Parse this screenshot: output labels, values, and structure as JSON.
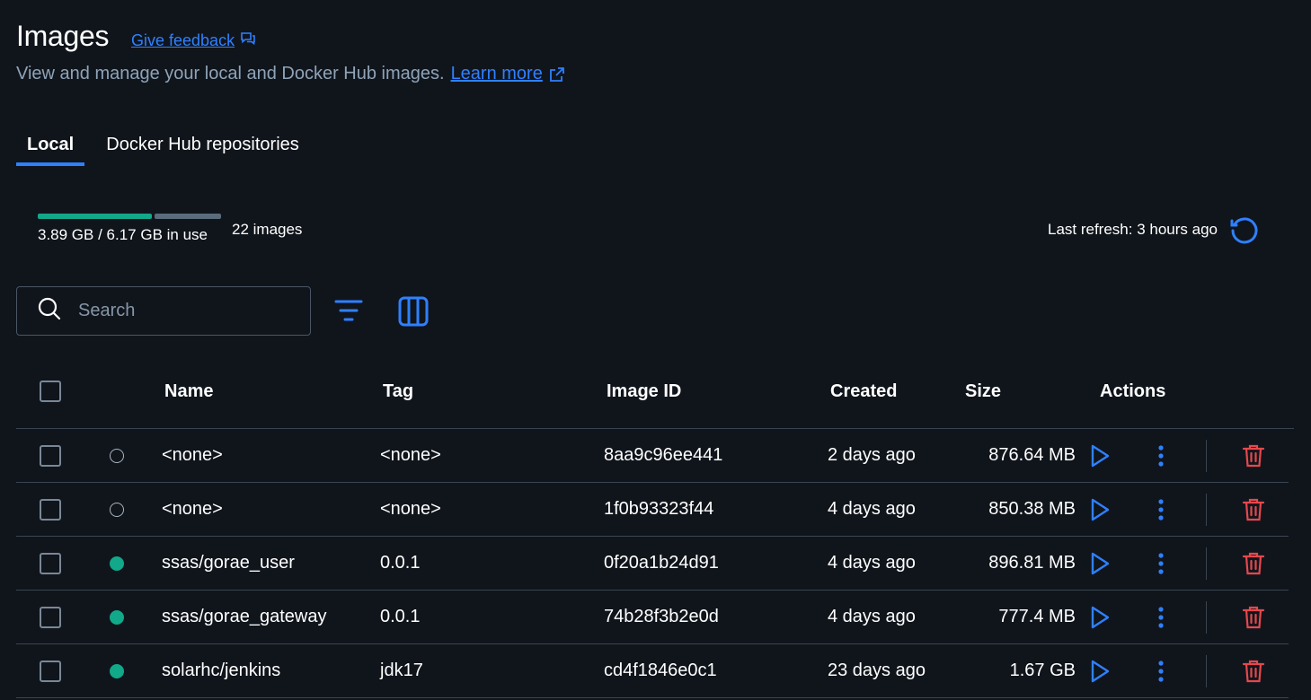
{
  "header": {
    "title": "Images",
    "feedback_label": "Give feedback",
    "subtitle": "View and manage your local and Docker Hub images.",
    "learn_more_label": "Learn more"
  },
  "tabs": [
    {
      "label": "Local",
      "active": true
    },
    {
      "label": "Docker Hub repositories",
      "active": false
    }
  ],
  "usage": {
    "text": "3.89 GB / 6.17 GB in use",
    "used_fraction": 0.63,
    "count_text": "22 images",
    "last_refresh": "Last refresh: 3 hours ago"
  },
  "search": {
    "placeholder": "Search",
    "value": ""
  },
  "table": {
    "columns": {
      "name": "Name",
      "tag": "Tag",
      "image_id": "Image ID",
      "created": "Created",
      "size": "Size",
      "actions": "Actions"
    },
    "rows": [
      {
        "name": "<none>",
        "tag": "<none>",
        "image_id": "8aa9c96ee441",
        "created": "2 days ago",
        "size": "876.64 MB",
        "in_use": false
      },
      {
        "name": "<none>",
        "tag": "<none>",
        "image_id": "1f0b93323f44",
        "created": "4 days ago",
        "size": "850.38 MB",
        "in_use": false
      },
      {
        "name": "ssas/gorae_user",
        "tag": "0.0.1",
        "image_id": "0f20a1b24d91",
        "created": "4 days ago",
        "size": "896.81 MB",
        "in_use": true
      },
      {
        "name": "ssas/gorae_gateway",
        "tag": "0.0.1",
        "image_id": "74b28f3b2e0d",
        "created": "4 days ago",
        "size": "777.4 MB",
        "in_use": true
      },
      {
        "name": "solarhc/jenkins",
        "tag": "jdk17",
        "image_id": "cd4f1846e0c1",
        "created": "23 days ago",
        "size": "1.67 GB",
        "in_use": true
      }
    ]
  },
  "icons": {
    "feedback": "chat-bubble-icon",
    "learn_more": "external-link-icon",
    "refresh": "refresh-icon",
    "search": "search-icon",
    "filter": "filter-icon",
    "columns": "columns-icon",
    "run": "play-icon",
    "more": "more-vertical-icon",
    "delete": "trash-icon"
  },
  "colors": {
    "background": "#10151c",
    "accent": "#2f80ff",
    "in_use": "#12a88a",
    "danger": "#e5484d"
  }
}
